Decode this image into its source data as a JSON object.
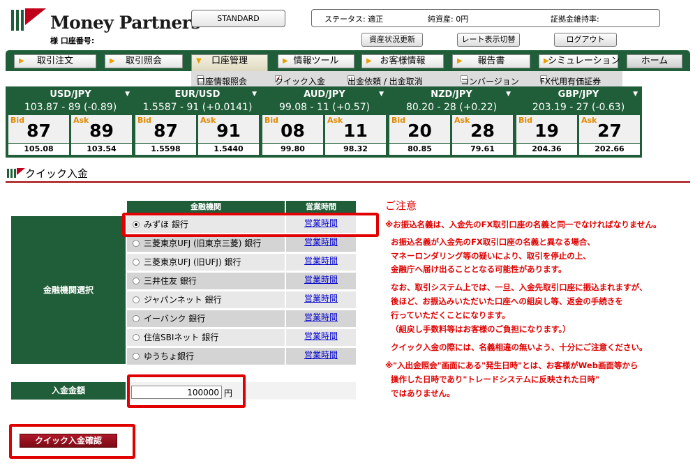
{
  "brand": {
    "name": "Money Partners",
    "colors": {
      "green": "#1f5e38",
      "red": "#e00000"
    }
  },
  "account": {
    "label": "様 口座番号:"
  },
  "plan": "STANDARD",
  "status": {
    "status": "ステータス: 適正",
    "assets": "純資産: 0円",
    "margin": "証拠金維持率:"
  },
  "buttons": {
    "refresh": "資産状況更新",
    "rate_toggle": "レート表示切替",
    "logout": "ログアウト"
  },
  "nav": [
    "取引注文",
    "取引照会",
    "口座管理",
    "情報ツール",
    "お客様情報",
    "報告書",
    "シミュレーション",
    "ホーム"
  ],
  "subnav": [
    "口座情報照会",
    "クイック入金",
    "出金依頼 / 出金取消",
    "コンバージョン",
    "FX代用有価証券"
  ],
  "rates": [
    {
      "pair": "USD/JPY",
      "spot": "103.87 - 89 (-0.89)",
      "bid_tag": "Bid",
      "bid": "87",
      "ask_tag": "Ask",
      "ask": "89",
      "high": "105.08",
      "low": "103.54"
    },
    {
      "pair": "EUR/USD",
      "spot": "1.5587 - 91 (+0.0141)",
      "bid_tag": "Bid",
      "bid": "87",
      "ask_tag": "Ask",
      "ask": "91",
      "high": "1.5598",
      "low": "1.5440"
    },
    {
      "pair": "AUD/JPY",
      "spot": "99.08 - 11 (+0.57)",
      "bid_tag": "Bid",
      "bid": "08",
      "ask_tag": "Ask",
      "ask": "11",
      "high": "99.80",
      "low": "98.32"
    },
    {
      "pair": "NZD/JPY",
      "spot": "80.20 - 28 (+0.22)",
      "bid_tag": "Bid",
      "bid": "20",
      "ask_tag": "Ask",
      "ask": "28",
      "high": "80.85",
      "low": "79.61"
    },
    {
      "pair": "GBP/JPY",
      "spot": "203.19 - 27 (-0.63)",
      "bid_tag": "Bid",
      "bid": "19",
      "ask_tag": "Ask",
      "ask": "27",
      "high": "204.36",
      "low": "202.66"
    }
  ],
  "section_title": "クイック入金",
  "table": {
    "headers": [
      "金融機関",
      "営業時間"
    ],
    "select_label": "金融機関選択",
    "hours_link": "営業時間",
    "banks": [
      "みずほ 銀行",
      "三菱東京UFJ (旧東京三菱) 銀行",
      "三菱東京UFJ (旧UFJ) 銀行",
      "三井住友 銀行",
      "ジャパンネット 銀行",
      "イーバンク 銀行",
      "住信SBIネット 銀行",
      "ゆうちょ銀行"
    ],
    "selected_index": 0
  },
  "amount": {
    "label": "入金金額",
    "value": "100000",
    "unit": "円"
  },
  "confirm_label": "クイック入金確認",
  "notes": {
    "title": "ご注意",
    "lines": [
      "※お振込名義は、入金先のFX取引口座の名義と同一でなければなりません。",
      "お振込名義が入金先のFX取引口座の名義と異なる場合、",
      "マネーロンダリング等の疑いにより、取引を停止の上、",
      "金融庁へ届け出ることとなる可能性があります。",
      "なお、取引システム上では、一旦、入金先取引口座に振込まれますが、",
      "後ほど、お振込みいただいた口座への組戻し等、返金の手続きを",
      "行っていただくことになります。",
      "（組戻し手数料等はお客様のご負担になります。）",
      "クイック入金の際には、名義相違の無いよう、十分にご注意ください。",
      "※\"入出金照会\"画面にある\"発生日時\"とは、お客様がWeb画面等から",
      "操作した日時であり\"トレードシステムに反映された日時\"",
      "ではありません。"
    ]
  }
}
